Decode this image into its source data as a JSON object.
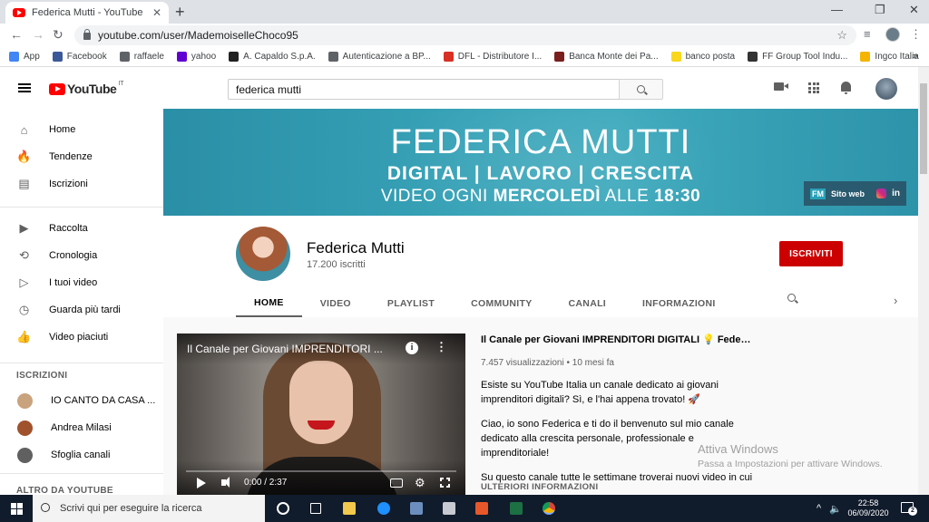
{
  "browser": {
    "tab_title": "Federica Mutti - YouTube",
    "url": "youtube.com/user/MademoiselleChoco95",
    "bookmarks": [
      {
        "label": "App",
        "icon": "apps-grid-icon",
        "color": "#4285f4"
      },
      {
        "label": "Facebook",
        "icon": "facebook-icon",
        "color": "#3b5998"
      },
      {
        "label": "raffaele",
        "icon": "globe-icon",
        "color": "#5f6368"
      },
      {
        "label": "yahoo",
        "icon": "yahoo-icon",
        "color": "#6001d2"
      },
      {
        "label": "A. Capaldo S.p.A.",
        "icon": "capaldo-icon",
        "color": "#222222"
      },
      {
        "label": "Autenticazione a BP...",
        "icon": "globe-icon",
        "color": "#5f6368"
      },
      {
        "label": "DFL - Distributore I...",
        "icon": "dfl-icon",
        "color": "#d93025"
      },
      {
        "label": "Banca Monte dei Pa...",
        "icon": "mps-icon",
        "color": "#7b1e1e"
      },
      {
        "label": "banco posta",
        "icon": "poste-icon",
        "color": "#f9d71c"
      },
      {
        "label": "FF Group Tool Indu...",
        "icon": "ff-icon",
        "color": "#333333"
      },
      {
        "label": "Ingco Italia",
        "icon": "ingco-icon",
        "color": "#f4b400"
      }
    ]
  },
  "youtube": {
    "logo_text": "YouTube",
    "logo_country": "IT",
    "search_value": "federica mutti"
  },
  "sidebar": {
    "main_items": [
      {
        "label": "Home",
        "icon": "home-icon",
        "glyph": "⌂"
      },
      {
        "label": "Tendenze",
        "icon": "fire-icon",
        "glyph": "🔥"
      },
      {
        "label": "Iscrizioni",
        "icon": "subscriptions-icon",
        "glyph": "▤"
      }
    ],
    "library_items": [
      {
        "label": "Raccolta",
        "icon": "library-icon",
        "glyph": "▶"
      },
      {
        "label": "Cronologia",
        "icon": "history-icon",
        "glyph": "⟲"
      },
      {
        "label": "I tuoi video",
        "icon": "your-videos-icon",
        "glyph": "▷"
      },
      {
        "label": "Guarda più tardi",
        "icon": "watch-later-icon",
        "glyph": "◷"
      },
      {
        "label": "Video piaciuti",
        "icon": "thumbs-up-icon",
        "glyph": "👍"
      }
    ],
    "subs_heading": "ISCRIZIONI",
    "subscriptions": [
      {
        "label": "IO CANTO DA CASA ...",
        "color": "#c9a27e"
      },
      {
        "label": "Andrea Milasi",
        "color": "#a0522d"
      },
      {
        "label": "Sfoglia canali",
        "color": "#606060"
      }
    ],
    "more_heading": "ALTRO DA YOUTUBE"
  },
  "banner": {
    "title": "FEDERICA MUTTI",
    "subtitle": "DIGITAL | LAVORO | CRESCITA",
    "schedule_pre": "VIDEO OGNI ",
    "schedule_day": "MERCOLEDÌ",
    "schedule_mid": " ALLE ",
    "schedule_time": "18:30",
    "fm_badge": "FM",
    "site_link": "Sito web",
    "linkedin": "in"
  },
  "channel": {
    "name": "Federica Mutti",
    "subscribers": "17.200 iscritti",
    "subscribe_label": "ISCRIVITI",
    "tabs": [
      "HOME",
      "VIDEO",
      "PLAYLIST",
      "COMMUNITY",
      "CANALI",
      "INFORMAZIONI"
    ]
  },
  "featured": {
    "player_title": "Il Canale per Giovani IMPRENDITORI ...",
    "time": "0:00 / 2:37",
    "progress": 0,
    "title": "Il Canale per Giovani IMPRENDITORI DIGITALI 💡 Federica Mut...",
    "meta": "7.457 visualizzazioni • 10 mesi fa",
    "p1": "Esiste su YouTube Italia un canale dedicato ai giovani imprenditori digitali? Sì, e l'hai appena trovato! 🚀",
    "p2": "Ciao, io sono Federica e ti do il benvenuto sul mio canale dedicato alla crescita personale, professionale e imprenditoriale!",
    "p3": "Su questo canale tutte le settimane troverai nuovi video in cui",
    "more_info": "ULTERIORI INFORMAZIONI"
  },
  "watermark": {
    "line1": "Attiva Windows",
    "line2": "Passa a Impostazioni per attivare Windows."
  },
  "taskbar": {
    "search_placeholder": "Scrivi qui per eseguire la ricerca",
    "time": "22:58",
    "date": "06/09/2020",
    "notifications": "2"
  }
}
